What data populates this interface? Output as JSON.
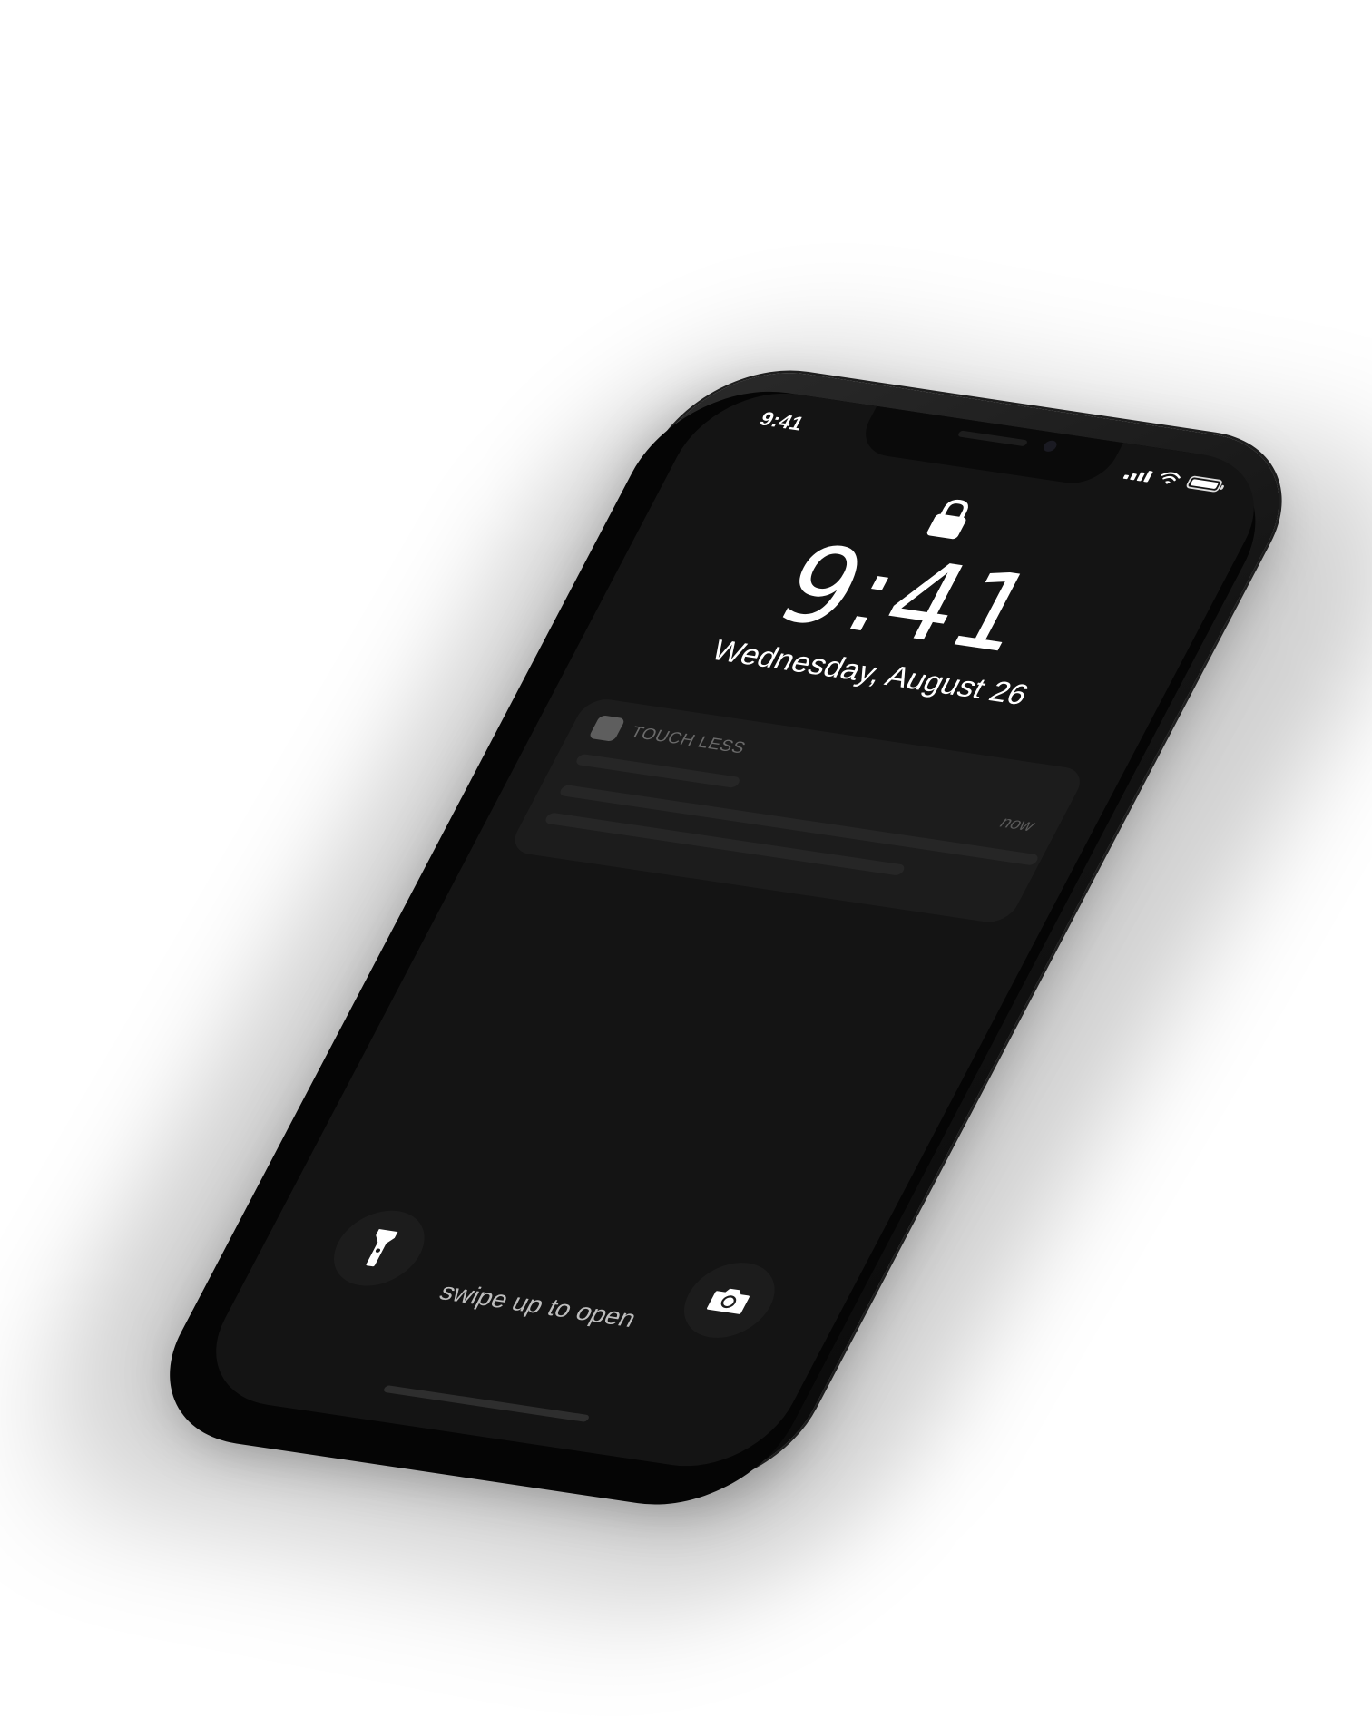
{
  "status_bar": {
    "time": "9:41",
    "icons": [
      "signal-icon",
      "wifi-icon",
      "battery-icon"
    ]
  },
  "lock_screen": {
    "lock_icon": "lock-icon",
    "time": "9:41",
    "date": "Wednesday, August 26"
  },
  "notification": {
    "app_name": "TOUCH LESS",
    "timestamp": "now"
  },
  "bottom": {
    "flashlight_icon": "flashlight-icon",
    "camera_icon": "camera-icon",
    "swipe_label": "swipe up to open"
  },
  "colors": {
    "screen_bg": "#141414",
    "notification_bg": "#1c1c1c",
    "text_primary": "#ffffff",
    "text_muted": "#6a6a6a"
  }
}
